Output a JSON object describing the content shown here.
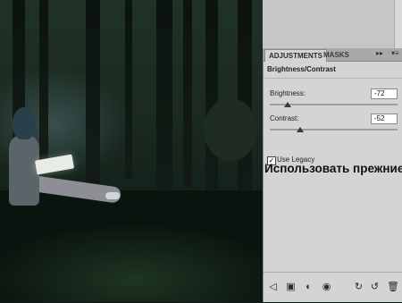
{
  "panel": {
    "tabs": [
      {
        "label": "ADJUSTMENTS"
      },
      {
        "label": "MASKS"
      }
    ],
    "tab_arrows": "▸▸",
    "tab_menu": "▾≡",
    "title": "Brightness/Contrast",
    "brightness": {
      "label": "Brightness:",
      "value": "-72",
      "slider_fraction": 0.14
    },
    "contrast": {
      "label": "Contrast:",
      "value": "-52",
      "slider_fraction": 0.24
    },
    "use_legacy": {
      "label": "Use Legacy",
      "checked": true,
      "mark": "✓"
    },
    "bottom_icons": [
      "back-arrow-icon",
      "expand-view-icon",
      "clip-layer-icon",
      "visibility-eye-icon",
      "view-previous-icon",
      "reset-icon",
      "delete-icon"
    ],
    "bottom_glyphs": [
      "◁",
      "▣",
      "◐",
      "◉",
      "↻",
      "↺",
      "🗑"
    ]
  },
  "caption": "Использовать прежние"
}
